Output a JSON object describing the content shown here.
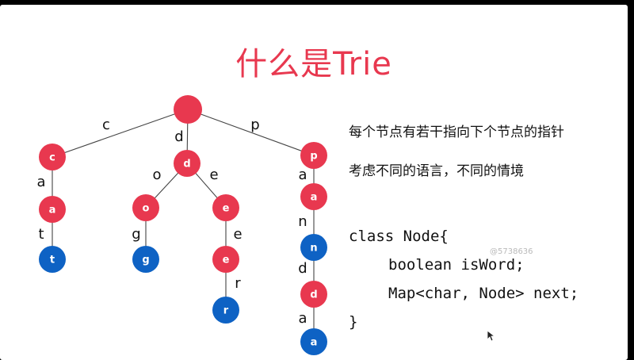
{
  "slide": {
    "title": "什么是Trie",
    "descriptions": [
      "每个节点有若干指向下个节点的指针",
      "考虑不同的语言，不同的情境"
    ],
    "code": [
      "class Node{",
      "boolean isWord;",
      "Map<char, Node> next;",
      "}"
    ],
    "watermark": "@5738636"
  },
  "colors": {
    "red_node": "#e8384f",
    "blue_node": "#0e62c4",
    "edge": "#444444",
    "title": "#e8384f"
  },
  "trie": {
    "nodes": [
      {
        "id": "root",
        "label": "",
        "kind": "red"
      },
      {
        "id": "c",
        "label": "c",
        "kind": "red"
      },
      {
        "id": "ca",
        "label": "a",
        "kind": "red"
      },
      {
        "id": "cat",
        "label": "t",
        "kind": "blue"
      },
      {
        "id": "d",
        "label": "d",
        "kind": "red"
      },
      {
        "id": "do",
        "label": "o",
        "kind": "red"
      },
      {
        "id": "dog",
        "label": "g",
        "kind": "blue"
      },
      {
        "id": "de",
        "label": "e",
        "kind": "red"
      },
      {
        "id": "dee",
        "label": "e",
        "kind": "red"
      },
      {
        "id": "deer",
        "label": "r",
        "kind": "blue"
      },
      {
        "id": "p",
        "label": "p",
        "kind": "red"
      },
      {
        "id": "pa",
        "label": "a",
        "kind": "red"
      },
      {
        "id": "pan",
        "label": "n",
        "kind": "blue"
      },
      {
        "id": "pand",
        "label": "d",
        "kind": "red"
      },
      {
        "id": "panda",
        "label": "a",
        "kind": "blue"
      }
    ],
    "edges": [
      {
        "from": "root",
        "to": "c",
        "label": "c"
      },
      {
        "from": "c",
        "to": "ca",
        "label": "a"
      },
      {
        "from": "ca",
        "to": "cat",
        "label": "t"
      },
      {
        "from": "root",
        "to": "d",
        "label": "d"
      },
      {
        "from": "d",
        "to": "do",
        "label": "o"
      },
      {
        "from": "do",
        "to": "dog",
        "label": "g"
      },
      {
        "from": "d",
        "to": "de",
        "label": "e"
      },
      {
        "from": "de",
        "to": "dee",
        "label": "e"
      },
      {
        "from": "dee",
        "to": "deer",
        "label": "r"
      },
      {
        "from": "root",
        "to": "p",
        "label": "p"
      },
      {
        "from": "p",
        "to": "pa",
        "label": "a"
      },
      {
        "from": "pa",
        "to": "pan",
        "label": "n"
      },
      {
        "from": "pan",
        "to": "pand",
        "label": "d"
      },
      {
        "from": "pand",
        "to": "panda",
        "label": "a"
      }
    ]
  }
}
